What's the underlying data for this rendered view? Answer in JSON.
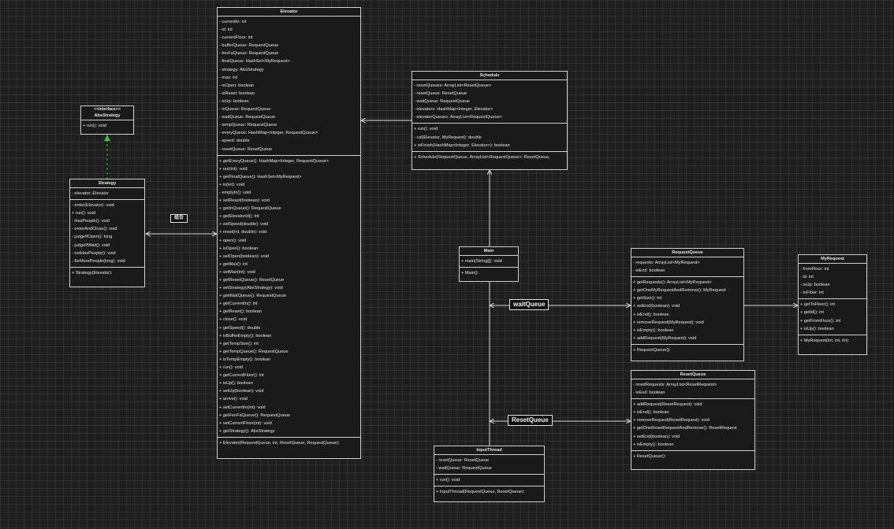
{
  "classes": {
    "elevator": {
      "name": "Elevator",
      "attributes": [
        "- currentIn: int",
        "- id: int",
        "- currentFloor: int",
        "- bufferQueue: RequestQueue",
        "- fenFaQueue: RequestQueue",
        "- finalQueue: HashSet<MyRequest>",
        "- strategy: AbsStrategy",
        "- max: int",
        "- isOpen: boolean",
        "- isReset: boolean",
        "- isUp: boolean",
        "- inQueue: RequestQueue",
        "- waitQueue: RequestQueue",
        "- tempQueue: RequestQueue",
        "- everyQueue: HashMap<Integer, RequestQueue>",
        "- speed: double",
        "- resetQueue: ResetQueue"
      ],
      "methods": [
        "+ getEveryQueue(): HashMap<Integer, RequestQueue>",
        "+ out(int): void",
        "+ getFinalQueue(): HashSet<MyRequest>",
        "+ in(int): void",
        "- emptyIn(): void",
        "+ setReset(boolean): void",
        "+ getInQueue(): RequestQueue",
        "+ getElevatorId(): int",
        "+ setSpeed(double): void",
        "+ reset(int, double): void",
        "+ open(): void",
        "+ isOpen(): boolean",
        "+ setOpen(boolean): void",
        "+ getMax(): int",
        "+ setMax(int): void",
        "+ getResetQueue(): ResetQueue",
        "+ setStrategy(AbsStrategy): void",
        "+ getWaitQueue(): RequestQueue",
        "+ getCurrentIn(): int",
        "+ getReset(): boolean",
        "+ close(): void",
        "+ getSpeed(): double",
        "+ isBufferEmpty(): boolean",
        "+ getTempSize(): int",
        "+ getTempQueue(): RequestQueue",
        "+ isTempEmpty(): boolean",
        "+ run(): void",
        "+ getCurrentFloor(): int",
        "+ isUp(): boolean",
        "+ setUp(boolean): void",
        "+ arrive(): void",
        "+ setCurrentIn(int): void",
        "+ getFenFaQueue(): RequestQueue",
        "+ setCurrentFloor(int): void",
        "+ getStrategy(): AbsStrategy"
      ],
      "constructors": [
        "+ Elevator(RequestQueue, int, ResetQueue, RequestQueue):"
      ]
    },
    "absStrategy": {
      "stereotype": "<<interface>>",
      "name": "AbsStrategy",
      "methods": [
        "+ run(): void"
      ]
    },
    "strategy": {
      "name": "Strategy",
      "attributes": [
        "- elevator: Elevator"
      ],
      "methods": [
        "- enter(Elevator): void",
        "+ run(): void",
        "- HasPeople(): void",
        "- enterAndClose(): void",
        "- judgeIfOpen(): long",
        "- judgeIfWait(): void",
        "- notHasPeople(): void",
        "- forMorePeople(long): void"
      ],
      "constructors": [
        "+ Strategy(Elevator):"
      ]
    },
    "schedule": {
      "name": "Schedule",
      "attributes": [
        "- resetQueues: ArrayList<ResetQueue>",
        "- resetQueue: ResetQueue",
        "- waitQueue: RequestQueue",
        "- elevators: HashMap<Integer, Elevator>",
        "- elevatorQueues: ArrayList<RequestQueue>"
      ],
      "methods": [
        "+ run(): void",
        "- cal(Elevator, MyRequest): double",
        "+ isFinish(HashMap<Integer, Elevator>): boolean"
      ],
      "constructors": [
        "+ Schedule(RequestQueue, ArrayList<RequestQueue>, ResetQueue, "
      ]
    },
    "main": {
      "name": "Main",
      "methods": [
        "+ main(String[]): void"
      ],
      "constructors": [
        "+ Main():"
      ]
    },
    "requestQueue": {
      "name": "RequestQueue",
      "attributes": [
        "- requests: ArrayList<MyRequest>",
        "- isEnd: boolean"
      ],
      "methods": [
        "+ getRequests(): ArrayList<MyRequest>",
        "+ getOneMyRequestAndRemove(): MyRequest",
        "+ getSize(): int",
        "+ setEnd(boolean): void",
        "+ isEnd(): boolean",
        "+ removeRequest(MyRequest): void",
        "+ isEmpty(): boolean",
        "+ addRequest(MyRequest): void"
      ],
      "constructors": [
        "+ RequestQueue():"
      ]
    },
    "myRequest": {
      "name": "MyRequest",
      "attributes": [
        "- fromFloor: int",
        "- id: int",
        "- isUp: boolean",
        "- toFloor: int"
      ],
      "methods": [
        "+ getToFloor(): int",
        "+ getId(): int",
        "+ getFromFloor(): int",
        "+ isUp(): boolean"
      ],
      "constructors": [
        "+ MyRequest(int, int, int):"
      ]
    },
    "resetQueue": {
      "name": "ResetQueue",
      "attributes": [
        "- resetRequests: ArrayList<ResetRequest>",
        "- isEnd: boolean"
      ],
      "methods": [
        "+ addRequest(ResetRequest): void",
        "+ isEnd(): boolean",
        "+ removeRequest(ResetRequest): void",
        "+ getOneResetRequestAndRemove(): ResetRequest",
        "+ setEnd(boolean): void",
        "+ isEmpty(): boolean"
      ],
      "constructors": [
        "+ ResetQueue():"
      ]
    },
    "inputThread": {
      "name": "InputThread",
      "attributes": [
        "- resetQueue: ResetQueue",
        "- waitQueue: RequestQueue"
      ],
      "methods": [
        "+ run(): void"
      ],
      "constructors": [
        "+ InputThread(RequestQueue, ResetQueue):"
      ]
    }
  },
  "edge_labels": {
    "strategy_elevator": "组合",
    "waitQueue": "waitQueue",
    "resetQueue": "ResetQueue"
  },
  "colors": {
    "background": "#1e1e1e",
    "line": "#d8d8d8",
    "realization": "#3fbf3f"
  }
}
